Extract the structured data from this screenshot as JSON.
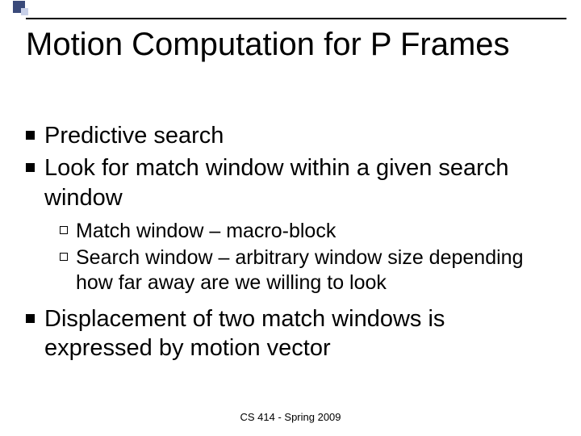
{
  "title": "Motion Computation for P Frames",
  "bullets": [
    {
      "text": "Predictive search"
    },
    {
      "text": "Look for match window within a given search window",
      "sub": [
        {
          "text": "Match window – macro-block"
        },
        {
          "text": "Search window – arbitrary window size depending how far away are we willing to look"
        }
      ]
    },
    {
      "text": "Displacement of two match windows is expressed by motion vector"
    }
  ],
  "footer": "CS 414 - Spring 2009"
}
